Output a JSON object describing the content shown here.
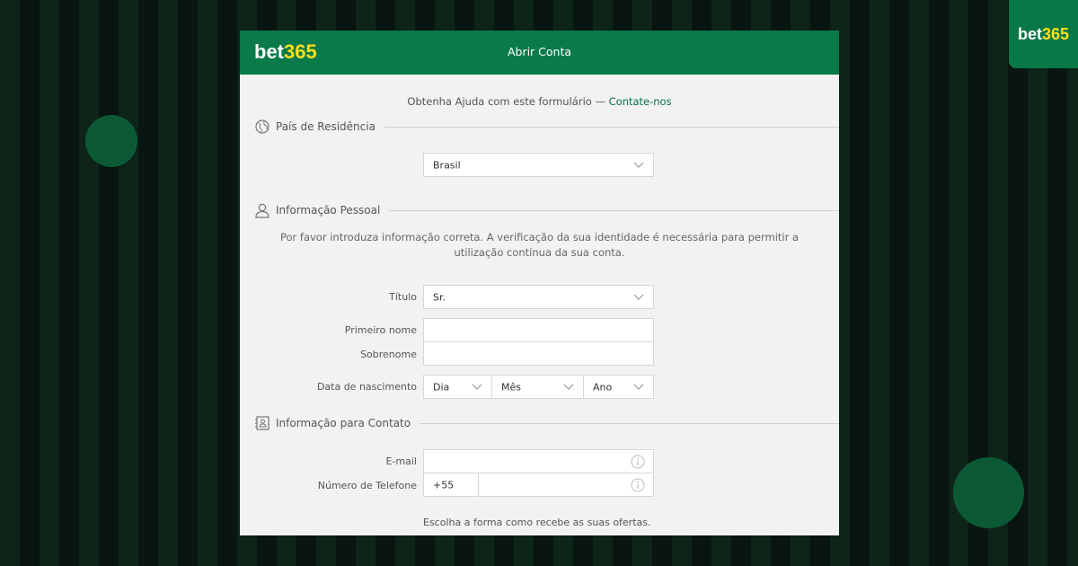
{
  "corner_logo": {
    "part1": "bet",
    "part2": "365"
  },
  "header": {
    "brand_part1": "bet",
    "brand_part2": "365",
    "title": "Abrir Conta"
  },
  "help": {
    "text": "Obtenha Ajuda com este formulário — ",
    "link": "Contate-nos"
  },
  "sections": {
    "residence": {
      "title": "País de Residência",
      "icon": "globe-icon",
      "country_value": "Brasil"
    },
    "personal": {
      "title": "Informação Pessoal",
      "icon": "person-icon",
      "description": "Por favor introduza informação correta. A verificação da sua identidade é necessária para permitir a utilização contínua da sua conta.",
      "title_label": "Título",
      "title_value": "Sr.",
      "first_name_label": "Primeiro nome",
      "first_name_value": "",
      "last_name_label": "Sobrenome",
      "last_name_value": "",
      "dob_label": "Data de nascimento",
      "dob_day": "Dia",
      "dob_month": "Mês",
      "dob_year": "Ano"
    },
    "contact": {
      "title": "Informação para Contato",
      "icon": "contact-card-icon",
      "email_label": "E-mail",
      "email_value": "",
      "phone_label": "Número de Telefone",
      "phone_prefix": "+55",
      "phone_value": "",
      "offers_text": "Escolha a forma como recebe as suas ofertas."
    }
  },
  "colors": {
    "brand_green": "#0a7a4a",
    "brand_yellow": "#ffdf1b",
    "link_green": "#0a6e4c"
  }
}
